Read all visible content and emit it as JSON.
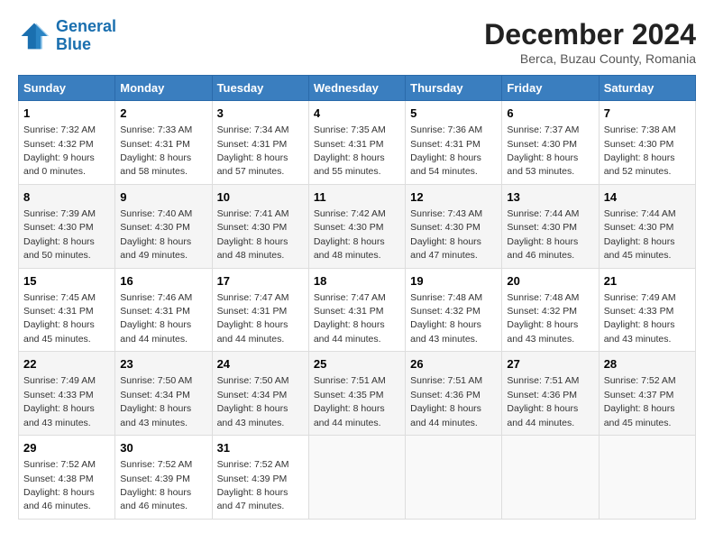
{
  "header": {
    "logo_line1": "General",
    "logo_line2": "Blue",
    "title": "December 2024",
    "subtitle": "Berca, Buzau County, Romania"
  },
  "days_of_week": [
    "Sunday",
    "Monday",
    "Tuesday",
    "Wednesday",
    "Thursday",
    "Friday",
    "Saturday"
  ],
  "weeks": [
    [
      {
        "day": "1",
        "sunrise": "7:32 AM",
        "sunset": "4:32 PM",
        "daylight": "9 hours and 0 minutes."
      },
      {
        "day": "2",
        "sunrise": "7:33 AM",
        "sunset": "4:31 PM",
        "daylight": "8 hours and 58 minutes."
      },
      {
        "day": "3",
        "sunrise": "7:34 AM",
        "sunset": "4:31 PM",
        "daylight": "8 hours and 57 minutes."
      },
      {
        "day": "4",
        "sunrise": "7:35 AM",
        "sunset": "4:31 PM",
        "daylight": "8 hours and 55 minutes."
      },
      {
        "day": "5",
        "sunrise": "7:36 AM",
        "sunset": "4:31 PM",
        "daylight": "8 hours and 54 minutes."
      },
      {
        "day": "6",
        "sunrise": "7:37 AM",
        "sunset": "4:30 PM",
        "daylight": "8 hours and 53 minutes."
      },
      {
        "day": "7",
        "sunrise": "7:38 AM",
        "sunset": "4:30 PM",
        "daylight": "8 hours and 52 minutes."
      }
    ],
    [
      {
        "day": "8",
        "sunrise": "7:39 AM",
        "sunset": "4:30 PM",
        "daylight": "8 hours and 50 minutes."
      },
      {
        "day": "9",
        "sunrise": "7:40 AM",
        "sunset": "4:30 PM",
        "daylight": "8 hours and 49 minutes."
      },
      {
        "day": "10",
        "sunrise": "7:41 AM",
        "sunset": "4:30 PM",
        "daylight": "8 hours and 48 minutes."
      },
      {
        "day": "11",
        "sunrise": "7:42 AM",
        "sunset": "4:30 PM",
        "daylight": "8 hours and 48 minutes."
      },
      {
        "day": "12",
        "sunrise": "7:43 AM",
        "sunset": "4:30 PM",
        "daylight": "8 hours and 47 minutes."
      },
      {
        "day": "13",
        "sunrise": "7:44 AM",
        "sunset": "4:30 PM",
        "daylight": "8 hours and 46 minutes."
      },
      {
        "day": "14",
        "sunrise": "7:44 AM",
        "sunset": "4:30 PM",
        "daylight": "8 hours and 45 minutes."
      }
    ],
    [
      {
        "day": "15",
        "sunrise": "7:45 AM",
        "sunset": "4:31 PM",
        "daylight": "8 hours and 45 minutes."
      },
      {
        "day": "16",
        "sunrise": "7:46 AM",
        "sunset": "4:31 PM",
        "daylight": "8 hours and 44 minutes."
      },
      {
        "day": "17",
        "sunrise": "7:47 AM",
        "sunset": "4:31 PM",
        "daylight": "8 hours and 44 minutes."
      },
      {
        "day": "18",
        "sunrise": "7:47 AM",
        "sunset": "4:31 PM",
        "daylight": "8 hours and 44 minutes."
      },
      {
        "day": "19",
        "sunrise": "7:48 AM",
        "sunset": "4:32 PM",
        "daylight": "8 hours and 43 minutes."
      },
      {
        "day": "20",
        "sunrise": "7:48 AM",
        "sunset": "4:32 PM",
        "daylight": "8 hours and 43 minutes."
      },
      {
        "day": "21",
        "sunrise": "7:49 AM",
        "sunset": "4:33 PM",
        "daylight": "8 hours and 43 minutes."
      }
    ],
    [
      {
        "day": "22",
        "sunrise": "7:49 AM",
        "sunset": "4:33 PM",
        "daylight": "8 hours and 43 minutes."
      },
      {
        "day": "23",
        "sunrise": "7:50 AM",
        "sunset": "4:34 PM",
        "daylight": "8 hours and 43 minutes."
      },
      {
        "day": "24",
        "sunrise": "7:50 AM",
        "sunset": "4:34 PM",
        "daylight": "8 hours and 43 minutes."
      },
      {
        "day": "25",
        "sunrise": "7:51 AM",
        "sunset": "4:35 PM",
        "daylight": "8 hours and 44 minutes."
      },
      {
        "day": "26",
        "sunrise": "7:51 AM",
        "sunset": "4:36 PM",
        "daylight": "8 hours and 44 minutes."
      },
      {
        "day": "27",
        "sunrise": "7:51 AM",
        "sunset": "4:36 PM",
        "daylight": "8 hours and 44 minutes."
      },
      {
        "day": "28",
        "sunrise": "7:52 AM",
        "sunset": "4:37 PM",
        "daylight": "8 hours and 45 minutes."
      }
    ],
    [
      {
        "day": "29",
        "sunrise": "7:52 AM",
        "sunset": "4:38 PM",
        "daylight": "8 hours and 46 minutes."
      },
      {
        "day": "30",
        "sunrise": "7:52 AM",
        "sunset": "4:39 PM",
        "daylight": "8 hours and 46 minutes."
      },
      {
        "day": "31",
        "sunrise": "7:52 AM",
        "sunset": "4:39 PM",
        "daylight": "8 hours and 47 minutes."
      },
      null,
      null,
      null,
      null
    ]
  ]
}
